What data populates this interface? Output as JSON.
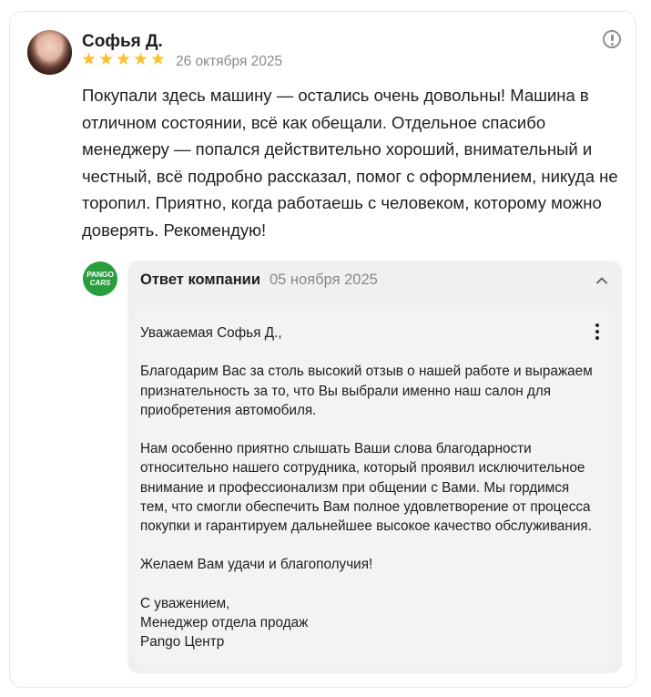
{
  "review": {
    "author": "Софья Д.",
    "rating": 5,
    "stars": [
      "★",
      "★",
      "★",
      "★",
      "★"
    ],
    "date": "26 октября 2025",
    "text": "Покупали здесь машину — остались очень довольны! Машина в отличном состоянии, всё как обещали. Отдельное спасибо менеджеру — попался действительно хороший, внимательный и честный, всё подробно рассказал, помог с оформлением, никуда не торопил. Приятно, когда работаешь с человеком, которому можно доверять. Рекомендую!"
  },
  "company": {
    "logo_line1": "PANGO",
    "logo_line2": "CARS",
    "logo_color": "#2a9d3d"
  },
  "reply": {
    "title": "Ответ компании",
    "date": "05 ноября 2025",
    "text": "Уважаемая Софья Д.,\n\nБлагодарим Вас за столь высокий отзыв о нашей работе и выражаем признательность за то, что Вы выбрали именно наш салон для приобретения автомобиля.\n\nНам особенно приятно слышать Ваши слова благодарности относительно нашего сотрудника, который проявил исключительное внимание и профессионализм при общении с Вами. Мы гордимся тем, что смогли обеспечить Вам полное удовлетворение от процесса покупки и гарантируем дальнейшее высокое качество обслуживания.\n\nЖелаем Вам удачи и благополучия!\n\nС уважением,\nМенеджер отдела продаж\nPango Центр"
  },
  "colors": {
    "star": "#fcc02e",
    "muted_text": "#898989",
    "reply_background": "#f0f0f0"
  },
  "icons": {
    "report": "exclamation-circle-icon",
    "collapse": "chevron-up-icon",
    "more": "vertical-dots-icon"
  }
}
